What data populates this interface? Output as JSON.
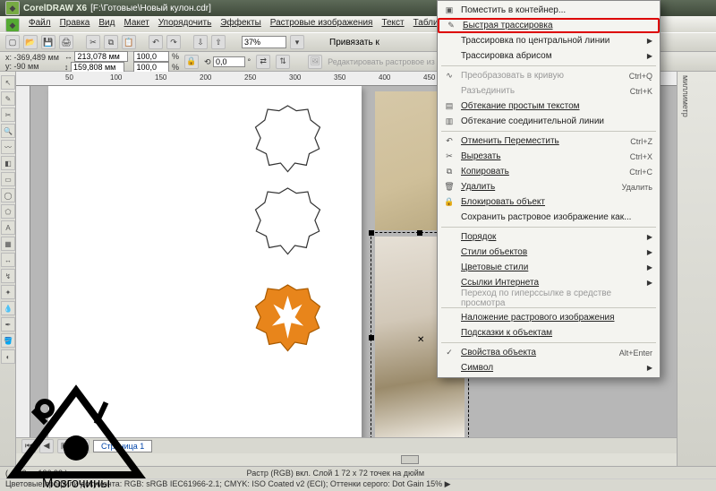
{
  "title": {
    "app": "CorelDRAW X6",
    "doc": "[F:\\Готовые\\Новый кулон.cdr]"
  },
  "menu": {
    "file": "Файл",
    "edit": "Правка",
    "view": "Вид",
    "layout": "Макет",
    "arrange": "Упорядочить",
    "effects": "Эффекты",
    "bitmaps": "Растровые изображения",
    "text": "Текст",
    "table": "Таблица"
  },
  "toolbar": {
    "zoom": "37%",
    "snap": "Привязать к"
  },
  "prop": {
    "x": "-369,489 мм",
    "y": "-90 мм",
    "w": "213,078 мм",
    "h": "159,808 мм",
    "sx": "100,0",
    "sy": "100,0",
    "rot": "0,0",
    "edit_bitmap": "Редактировать растровое из"
  },
  "ruler": {
    "t1": "50",
    "t2": "100",
    "t3": "150",
    "t4": "200",
    "t5": "250",
    "t6": "300",
    "t7": "350",
    "t8": "400",
    "t9": "450"
  },
  "ctx": {
    "place_container": "Поместить в контейнер...",
    "quick_trace": "Быстрая трассировка",
    "trace_centerline": "Трассировка по центральной линии",
    "trace_outline": "Трассировка абрисом",
    "to_curve": "Преобразовать в кривую",
    "to_curve_sc": "Ctrl+Q",
    "break": "Разъединить",
    "break_sc": "Ctrl+K",
    "wrap_simple": "Обтекание простым текстом",
    "wrap_connect": "Обтекание соединительной линии",
    "undo": "Отменить Переместить",
    "undo_sc": "Ctrl+Z",
    "cut": "Вырезать",
    "cut_sc": "Ctrl+X",
    "copy": "Копировать",
    "copy_sc": "Ctrl+C",
    "delete": "Удалить",
    "delete_sc": "Удалить",
    "lock": "Блокировать объект",
    "save_bitmap": "Сохранить растровое изображение как...",
    "order": "Порядок",
    "obj_styles": "Стили объектов",
    "color_styles": "Цветовые стили",
    "internet": "Ссылки Интернета",
    "hyperlink": "Переход по гиперссылке в средстве просмотра",
    "overlay": "Наложение растрового изображения",
    "hints": "Подсказки к объектам",
    "props": "Свойства объекта",
    "props_sc": "Alt+Enter",
    "symbol": "Символ"
  },
  "pagetab": "Страница 1",
  "millimeters": "миллиметр",
  "status": {
    "left": "( -372,    , -136,93    )",
    "center": "Растр (RGB) вкл. Слой 1 72 x 72 точек на дюйм",
    "profiles": "Цветовые профили документа: RGB: sRGB IEC61966-2.1; CMYK: ISO Coated v2 (ECI); Оттенки серого: Dot Gain 15% ▶"
  },
  "watermark": "Мозгочины"
}
